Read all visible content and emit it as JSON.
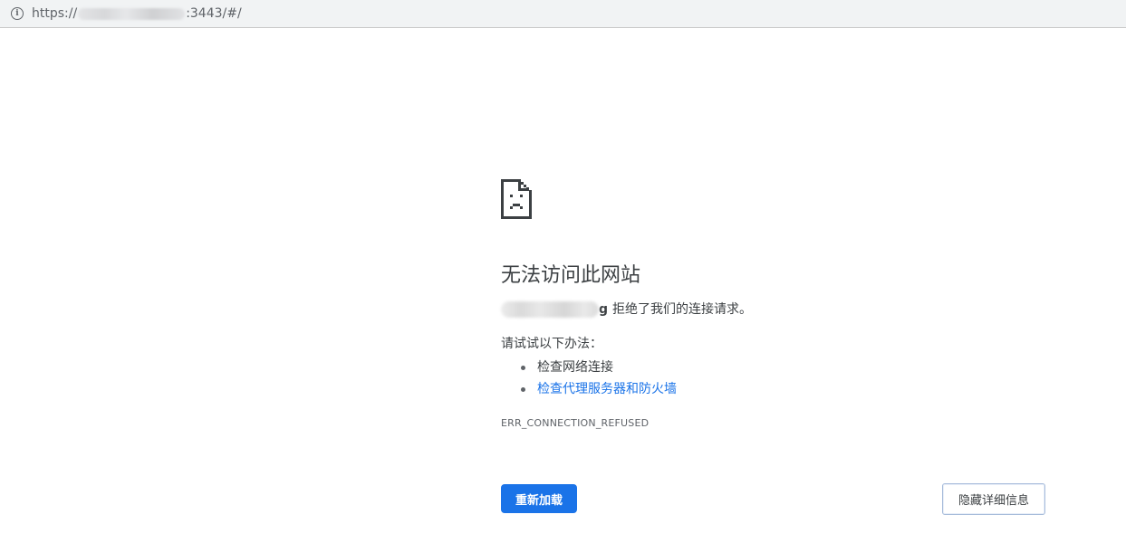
{
  "browser": {
    "url_prefix": "https://",
    "url_suffix": ":3443/#/",
    "info_icon_glyph": "i"
  },
  "error": {
    "icon": "sad-page-icon",
    "heading": "无法访问此网站",
    "host_tail": "g",
    "refused_text": "拒绝了我们的连接请求。",
    "try_title": "请试试以下办法：",
    "suggestions": [
      "检查网络连接",
      "检查代理服务器和防火墙"
    ],
    "code": "ERR_CONNECTION_REFUSED"
  },
  "buttons": {
    "reload": "重新加载",
    "details": "隐藏详细信息"
  },
  "colors": {
    "accent": "#1a73e8",
    "text": "#3c4043",
    "secondary_text": "#5f6368",
    "toolbar_bg": "#f1f3f4"
  }
}
